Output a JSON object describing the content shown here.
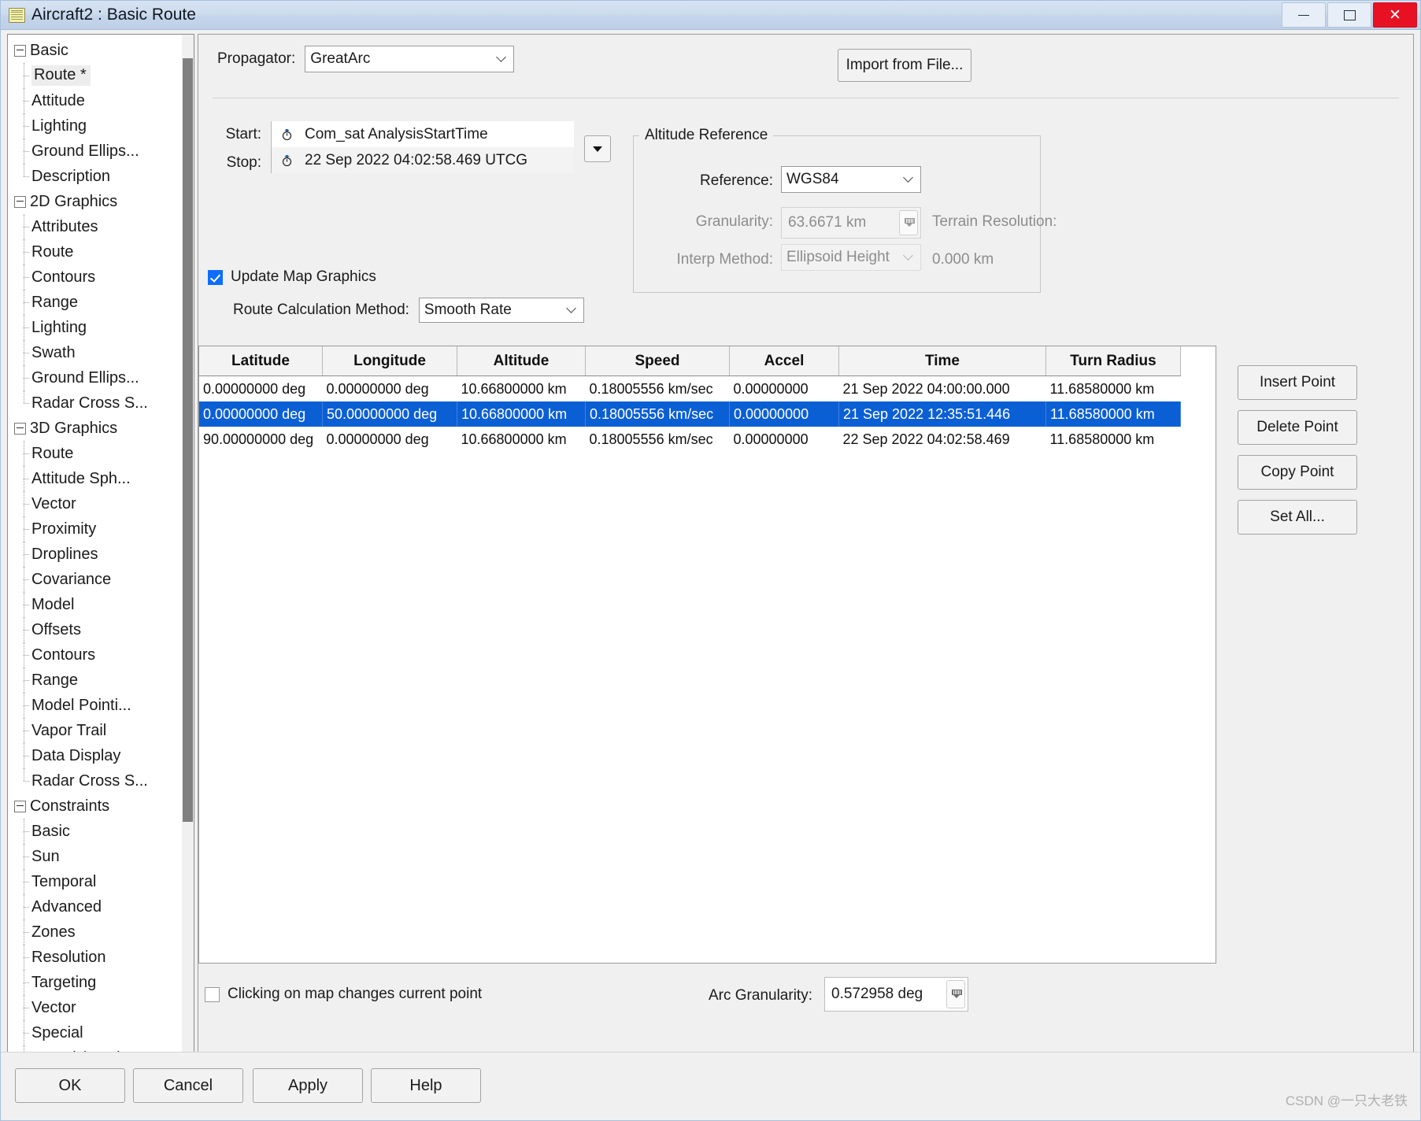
{
  "window": {
    "title": "Aircraft2 : Basic Route",
    "app_icon": "notepad-icon",
    "minimize": "–",
    "maximize": "□",
    "close": "✕"
  },
  "sidebar": {
    "groups": [
      {
        "label": "Basic",
        "items": [
          "Route *",
          "Attitude",
          "Lighting",
          "Ground Ellips...",
          "Description"
        ],
        "selected": "Route *"
      },
      {
        "label": "2D Graphics",
        "items": [
          "Attributes",
          "Route",
          "Contours",
          "Range",
          "Lighting",
          "Swath",
          "Ground Ellips...",
          "Radar Cross S..."
        ]
      },
      {
        "label": "3D Graphics",
        "items": [
          "Route",
          "Attitude Sph...",
          "Vector",
          "Proximity",
          "Droplines",
          "Covariance",
          "Model",
          "Offsets",
          "Contours",
          "Range",
          "Model Pointi...",
          "Vapor Trail",
          "Data Display",
          "Radar Cross S..."
        ]
      },
      {
        "label": "Constraints",
        "items": [
          "Basic",
          "Sun",
          "Temporal",
          "Advanced",
          "Zones",
          "Resolution",
          "Targeting",
          "Vector",
          "Special",
          "Search/Track"
        ]
      }
    ]
  },
  "main": {
    "propagator_label": "Propagator:",
    "propagator_value": "GreatArc",
    "import_button": "Import from File...",
    "start_label": "Start:",
    "start_value": "Com_sat AnalysisStartTime",
    "stop_label": "Stop:",
    "stop_value": "22 Sep 2022 04:02:58.469 UTCG",
    "update_map_graphics": "Update Map Graphics",
    "route_calc_label": "Route Calculation Method:",
    "route_calc_value": "Smooth Rate",
    "altitude_reference": {
      "title": "Altitude Reference",
      "reference_label": "Reference:",
      "reference_value": "WGS84",
      "granularity_label": "Granularity:",
      "granularity_value": "63.6671 km",
      "interp_label": "Interp Method:",
      "interp_value": "Ellipsoid Height",
      "terrain_resolution_label": "Terrain Resolution:",
      "terrain_resolution_value": "0.000 km"
    },
    "clicking_map_label": "Clicking on map changes current point",
    "arc_granularity_label": "Arc Granularity:",
    "arc_granularity_value": "0.572958 deg"
  },
  "table": {
    "columns": [
      "Latitude",
      "Longitude",
      "Altitude",
      "Speed",
      "Accel",
      "Time",
      "Turn Radius"
    ],
    "rows": [
      {
        "selected": false,
        "cells": [
          "0.00000000 deg",
          "0.00000000 deg",
          "10.66800000 km",
          "0.18005556 km/sec",
          "0.00000000",
          "21 Sep 2022 04:00:00.000",
          "11.68580000 km"
        ]
      },
      {
        "selected": true,
        "cells": [
          "0.00000000 deg",
          "50.00000000 deg",
          "10.66800000 km",
          "0.18005556 km/sec",
          "0.00000000",
          "21 Sep 2022 12:35:51.446",
          "11.68580000 km"
        ]
      },
      {
        "selected": false,
        "cells": [
          "90.00000000 deg",
          "0.00000000 deg",
          "10.66800000 km",
          "0.18005556 km/sec",
          "0.00000000",
          "22 Sep 2022 04:02:58.469",
          "11.68580000 km"
        ]
      }
    ]
  },
  "side_buttons": {
    "insert": "Insert Point",
    "delete": "Delete Point",
    "copy": "Copy Point",
    "set_all": "Set All..."
  },
  "bottom_buttons": {
    "ok": "OK",
    "cancel": "Cancel",
    "apply": "Apply",
    "help": "Help"
  },
  "watermark": "CSDN @一只大老铁",
  "colors": {
    "selection_blue": "#0b5fd4",
    "checkbox_blue": "#0d6efd",
    "close_red": "#e81123",
    "titlebar": "#cddcee"
  }
}
